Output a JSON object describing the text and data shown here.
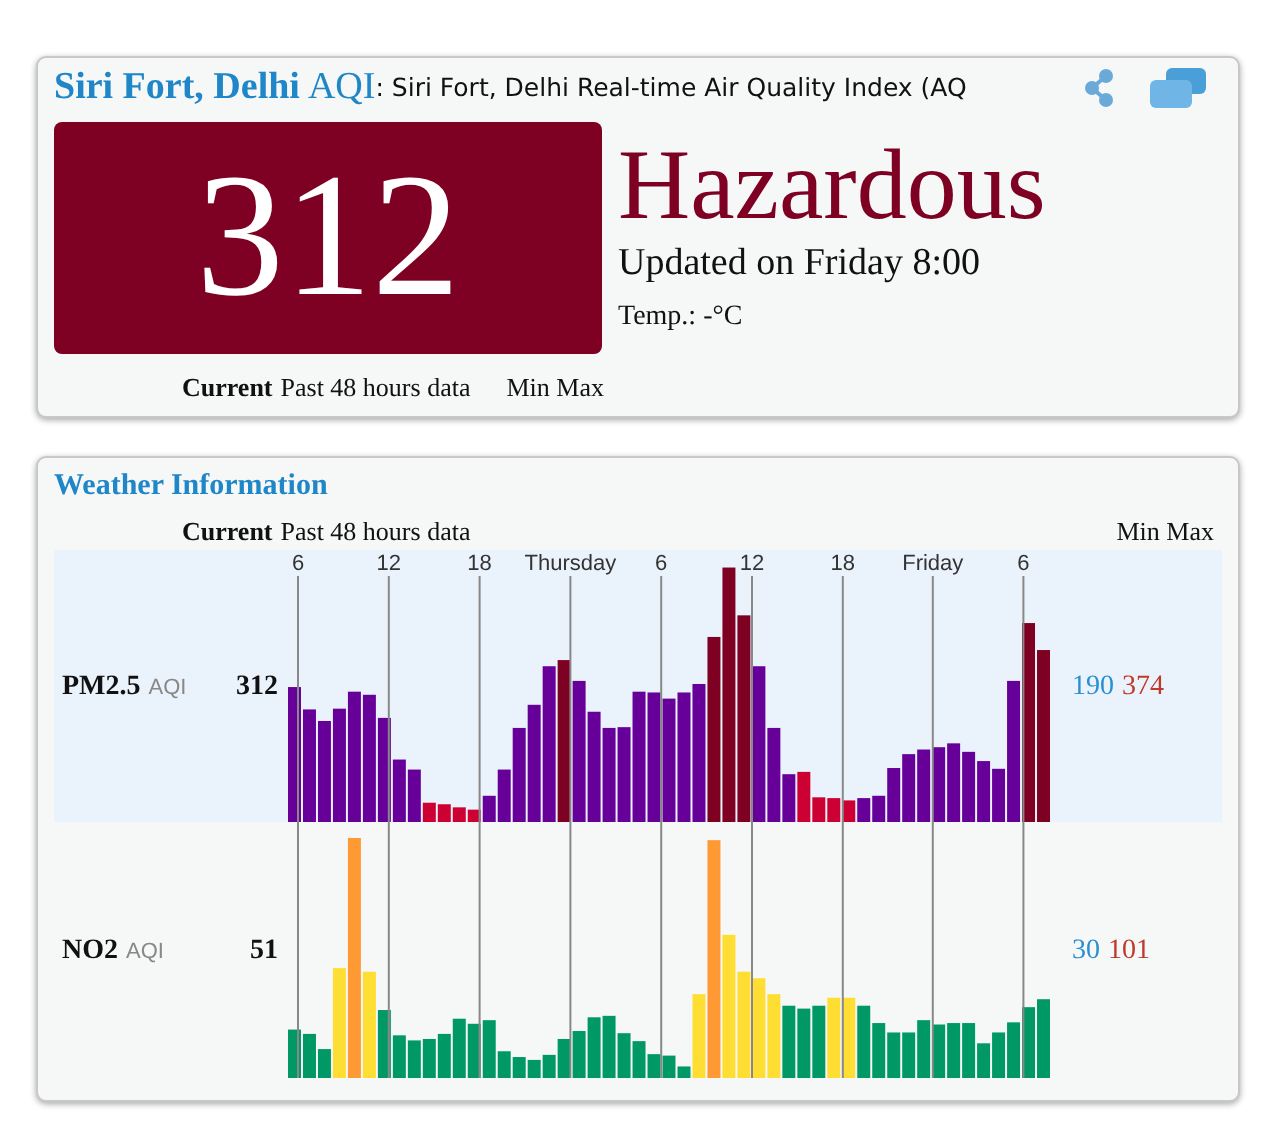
{
  "station_card": {
    "title": "Siri Fort, Delhi",
    "aqi_label": "AQI",
    "subtitle": ": Siri Fort, Delhi Real-time Air Quality Index (AQ",
    "aqi_value": "312",
    "status": "Hazardous",
    "updated": "Updated on Friday 8:00",
    "temperature": "Temp.: -°C",
    "header": {
      "current": "Current",
      "past": "Past 48 hours data",
      "minmax": "Min Max"
    }
  },
  "weather_card": {
    "title": "Weather Information",
    "header": {
      "current": "Current",
      "past": "Past 48 hours data",
      "minmax": "Min Max"
    },
    "time_labels": [
      "6",
      "12",
      "18",
      "Thursday",
      "6",
      "12",
      "18",
      "Friday",
      "6"
    ],
    "pollutants": [
      {
        "name": "PM2.5",
        "unit": "AQI",
        "current": "312",
        "min": "190",
        "max": "374"
      },
      {
        "name": "NO2",
        "unit": "AQI",
        "current": "51",
        "min": "30",
        "max": "101"
      }
    ]
  }
}
